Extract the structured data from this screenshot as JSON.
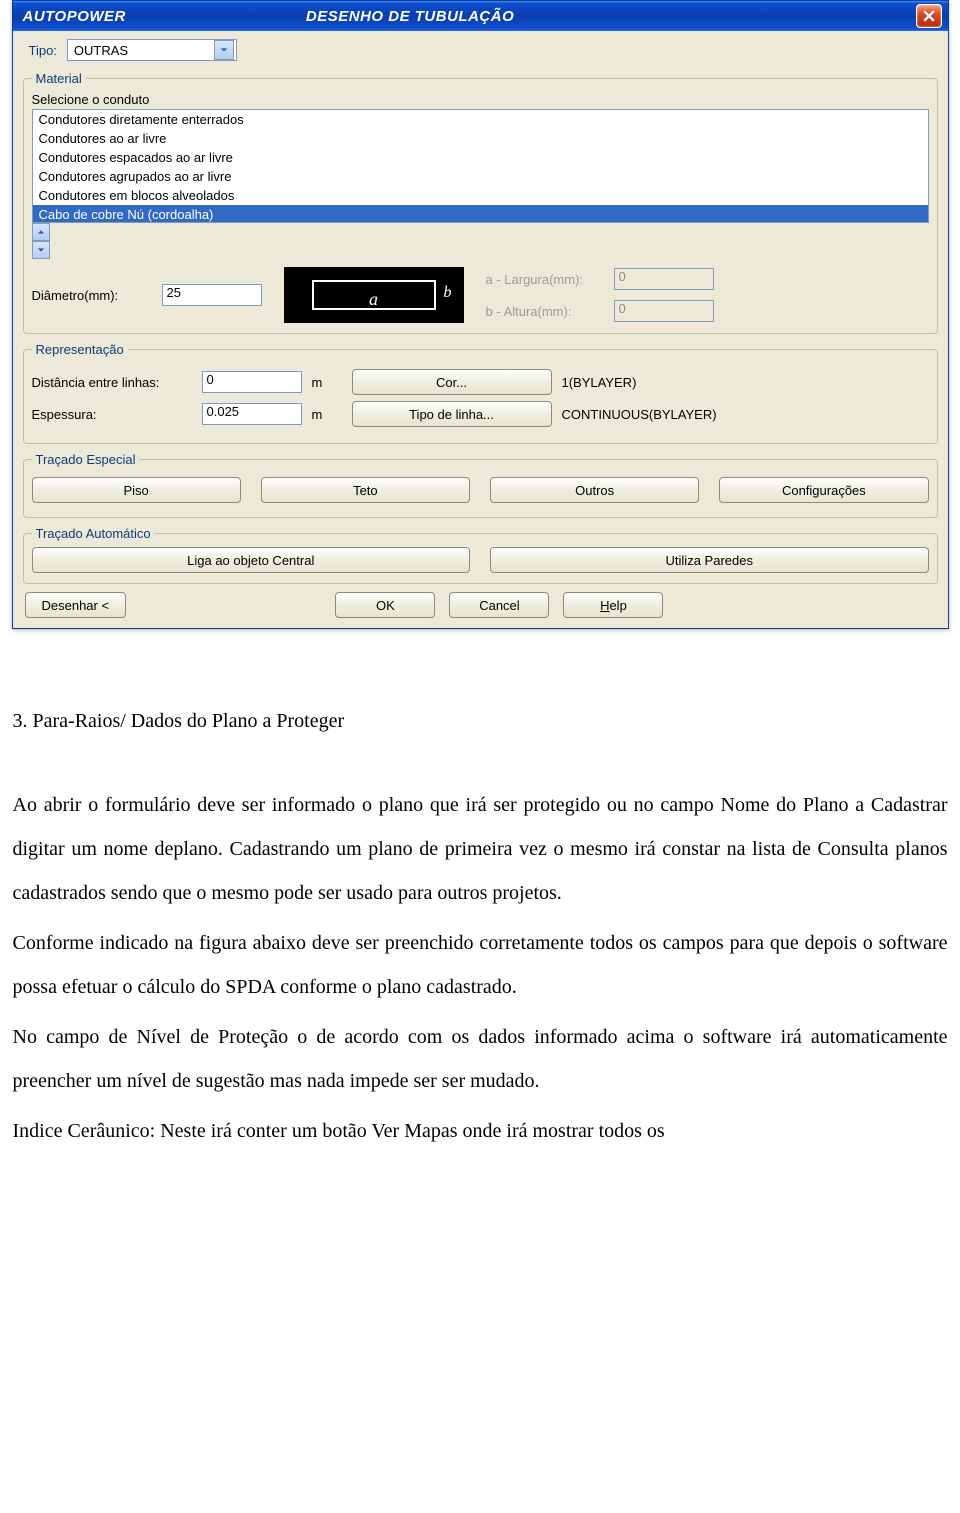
{
  "window": {
    "title_left": "AUTOPOWER",
    "title_center": "DESENHO DE TUBULAÇÃO"
  },
  "tipo": {
    "label": "Tipo:",
    "value": "OUTRAS"
  },
  "material": {
    "legend": "Material",
    "hint": "Selecione o conduto",
    "items": [
      "Condutores diretamente enterrados",
      "Condutores ao ar livre",
      "Condutores espacados ao ar livre",
      "Condutores agrupados ao ar livre",
      "Condutores em blocos alveolados",
      "Cabo de cobre Nú (cordoalha)"
    ],
    "selected_index": 5,
    "diametro_label": "Diâmetro(mm):",
    "diametro_value": "25",
    "a_label": "a - Largura(mm):",
    "a_value": "0",
    "b_label": "b - Altura(mm):",
    "b_value": "0"
  },
  "representacao": {
    "legend": "Representação",
    "dist_label": "Distância entre linhas:",
    "dist_value": "0",
    "dist_unit": "m",
    "esp_label": "Espessura:",
    "esp_value": "0.025",
    "esp_unit": "m",
    "cor_btn": "Cor...",
    "cor_value": "1(BYLAYER)",
    "tipo_linha_btn": "Tipo de linha...",
    "tipo_linha_value": "CONTINUOUS(BYLAYER)"
  },
  "tracado_especial": {
    "legend": "Traçado Especial",
    "piso": "Piso",
    "teto": "Teto",
    "outros": "Outros",
    "config": "Configurações"
  },
  "tracado_auto": {
    "legend": "Traçado Automático",
    "liga": "Liga ao objeto Central",
    "paredes": "Utiliza Paredes"
  },
  "bottom": {
    "desenhar": "Desenhar <",
    "ok": "OK",
    "cancel": "Cancel",
    "help_prefix": "H",
    "help_rest": "elp"
  },
  "doc": {
    "heading": "3.   Para-Raios/ Dados do Plano a Proteger",
    "p1": "Ao abrir o formulário deve ser informado o plano que irá ser protegido ou no campo Nome do Plano a Cadastrar digitar um nome deplano. Cadastrando um plano de primeira vez o mesmo irá constar na lista de Consulta planos cadastrados sendo que o mesmo pode ser usado para outros projetos.",
    "p2": "Conforme indicado na figura abaixo deve ser preenchido corretamente todos os campos para que depois o software possa efetuar o cálculo do SPDA conforme o plano cadastrado.",
    "p3": "No campo de Nível de Proteção o de acordo com os dados informado acima o software irá automaticamente   preencher um nível de sugestão mas nada impede ser ser mudado.",
    "p4": "Indice Cerâunico: Neste irá conter um botão Ver Mapas onde irá mostrar todos os"
  }
}
